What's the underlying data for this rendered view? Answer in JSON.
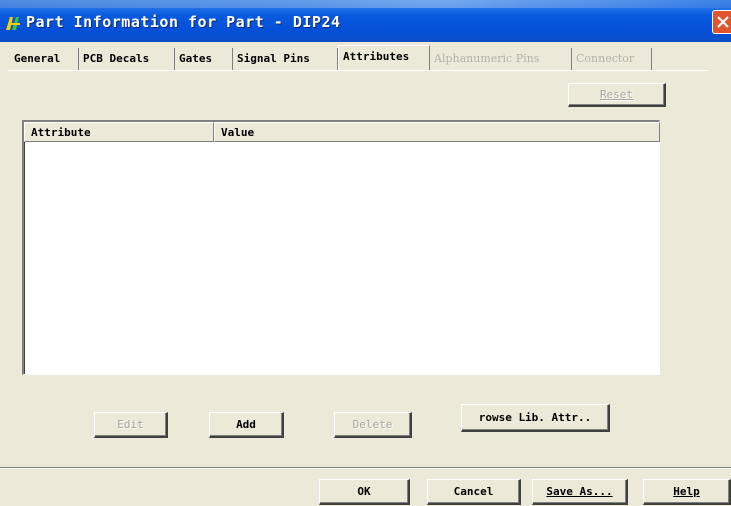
{
  "window": {
    "title": "Part Information for Part - DIP24"
  },
  "tabs": [
    {
      "label": "General",
      "state": "normal"
    },
    {
      "label": "PCB Decals",
      "state": "normal"
    },
    {
      "label": "Gates",
      "state": "normal"
    },
    {
      "label": "Signal Pins",
      "state": "normal"
    },
    {
      "label": "Attributes",
      "state": "active"
    },
    {
      "label": "Alphanumeric Pins",
      "state": "disabled"
    },
    {
      "label": "Connector",
      "state": "disabled"
    }
  ],
  "buttons": {
    "reset": "Reset",
    "edit": "Edit",
    "add": "Add",
    "delete": "Delete",
    "browse": "rowse Lib. Attr..",
    "ok": "OK",
    "cancel": "Cancel",
    "save_as": "Save As...",
    "help": "Help"
  },
  "table": {
    "columns": [
      "Attribute",
      "Value"
    ],
    "rows": []
  },
  "icons": {
    "app": "padslogic-icon",
    "close": "close-icon"
  }
}
